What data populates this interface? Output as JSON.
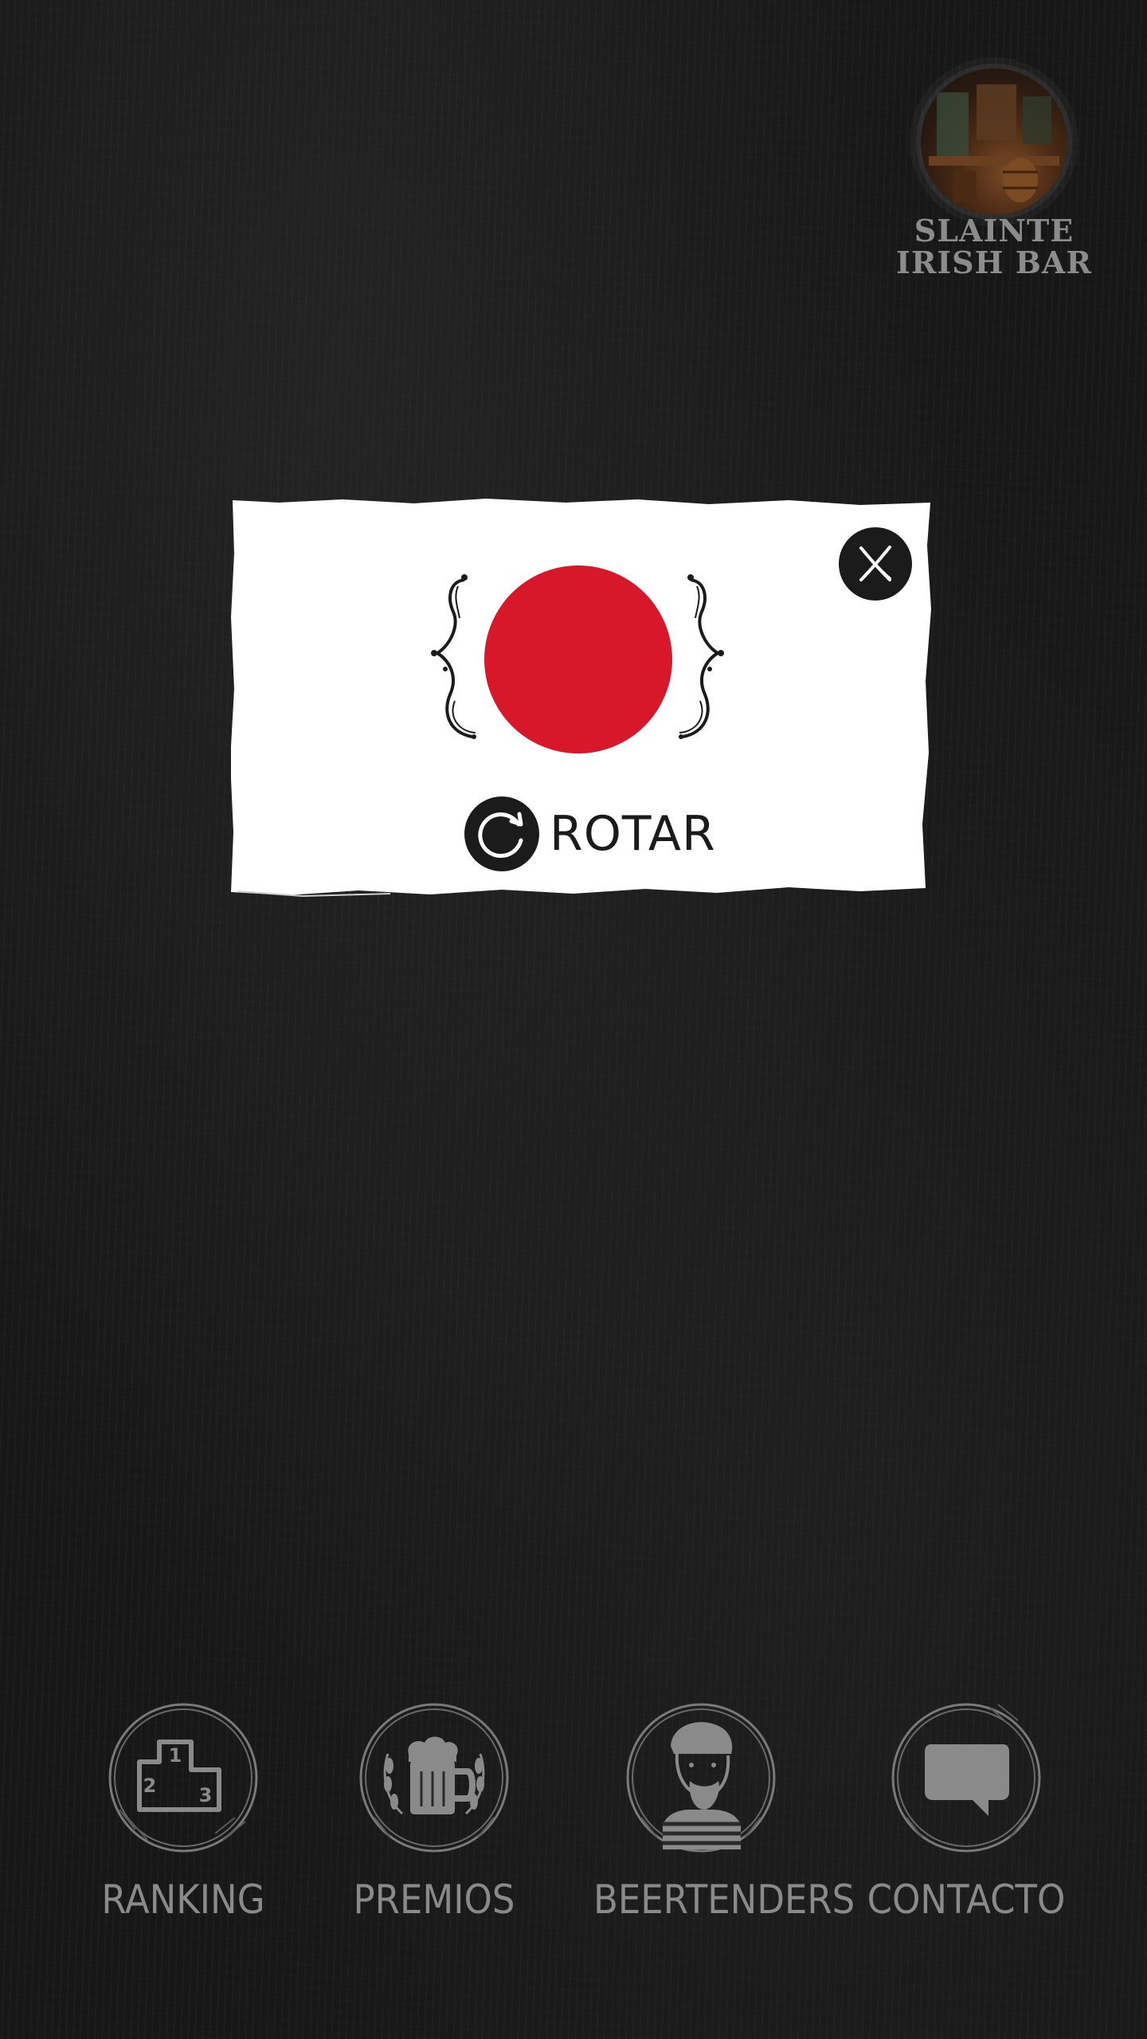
{
  "bar": {
    "name": "SLAINTE IRISH BAR",
    "logo_icon": "bar-interior-photo-badge"
  },
  "modal": {
    "close_icon": "close-x-icon",
    "flag_color": "#d7182a",
    "rotate_label": "ROTAR",
    "rotate_icon": "rotate-arrow-icon"
  },
  "nav": {
    "items": [
      {
        "label": "RANKING",
        "icon": "podium-icon"
      },
      {
        "label": "PREMIOS",
        "icon": "beer-mug-icon"
      },
      {
        "label": "BEERTENDERS",
        "icon": "bartender-icon"
      },
      {
        "label": "CONTACTO",
        "icon": "chat-bubble-icon"
      }
    ]
  },
  "colors": {
    "background": "#171717",
    "card": "#ffffff",
    "nav_gray": "#8a8a8a",
    "dark": "#1b1b1b"
  }
}
